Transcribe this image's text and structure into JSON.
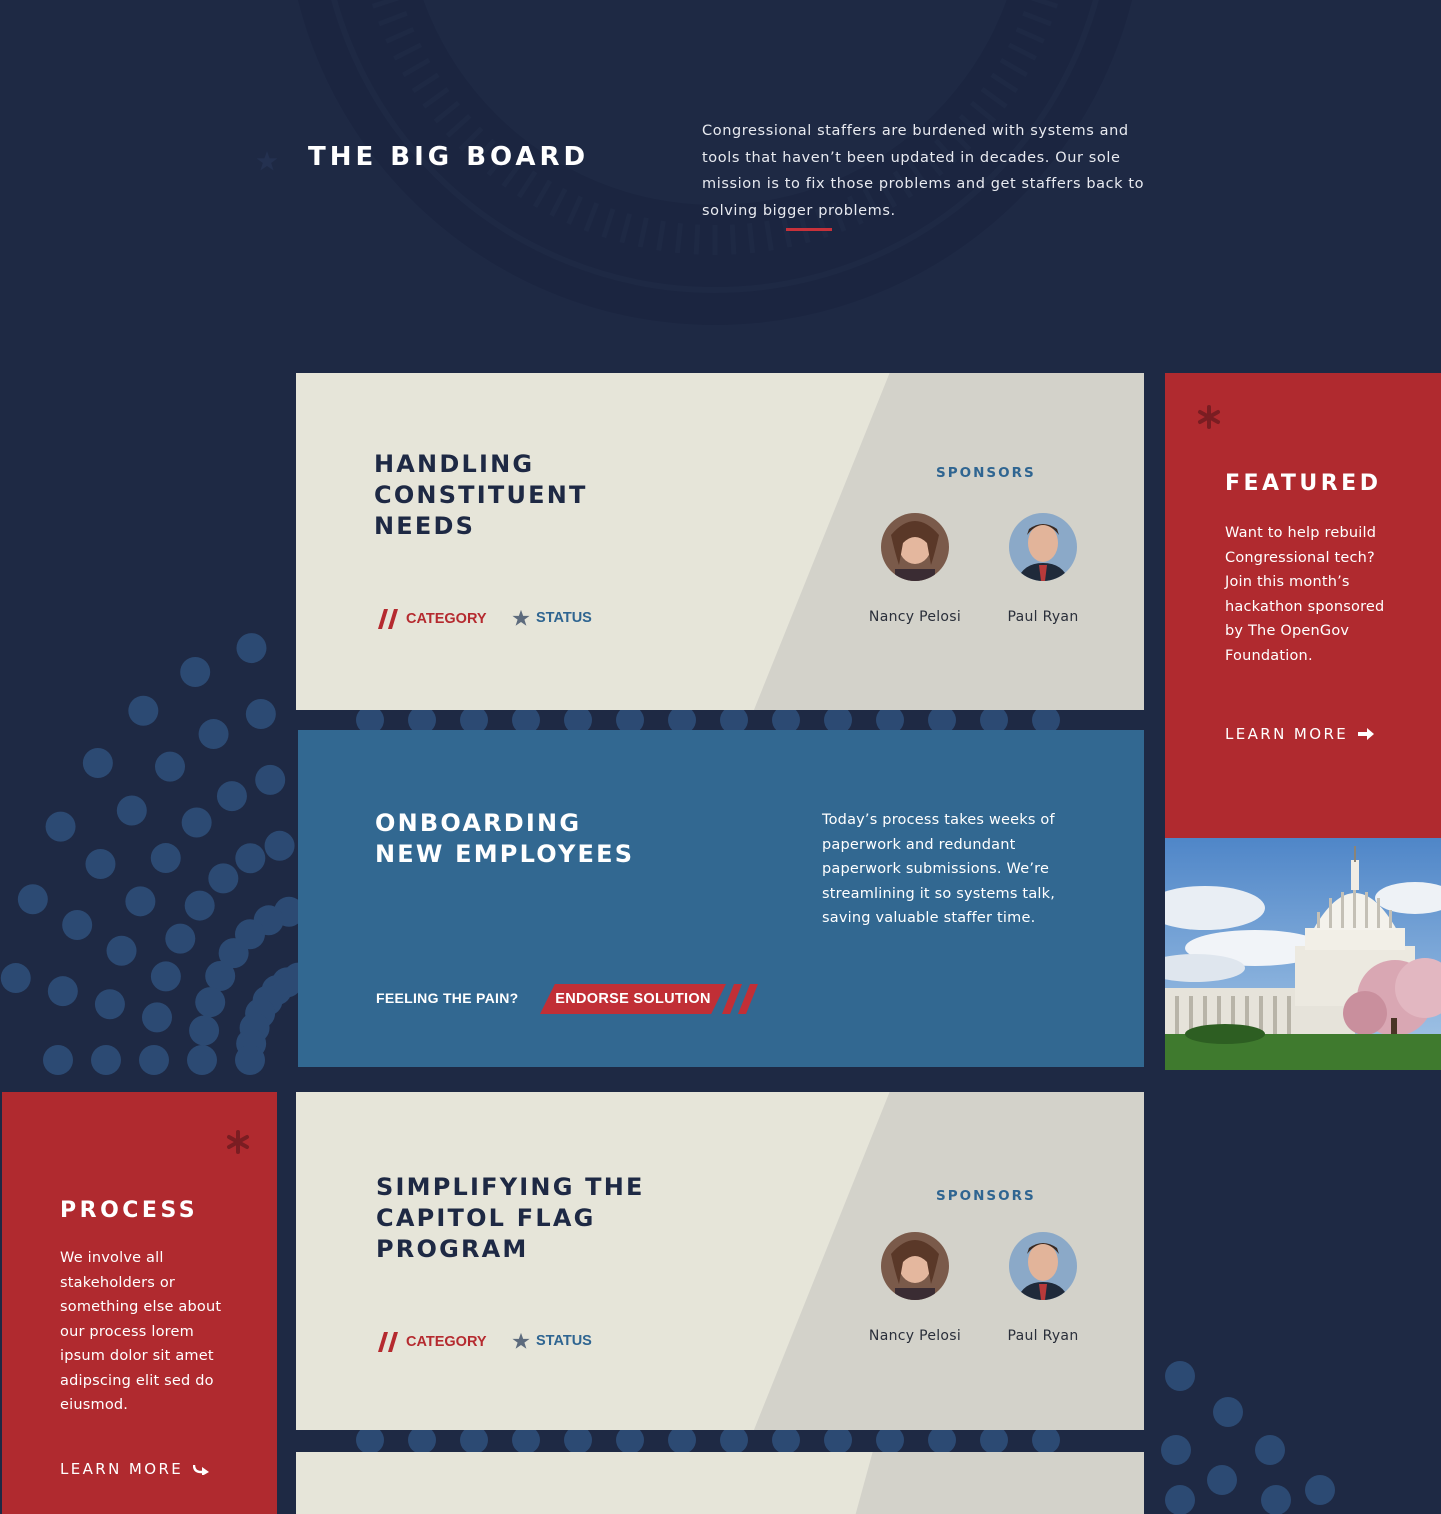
{
  "header": {
    "title": "THE BIG BOARD",
    "intro": "Congressional staffers are burdened with systems and tools that haven’t been updated in decades. Our sole mission is to fix those problems and get staffers back to solving bigger problems."
  },
  "cards": [
    {
      "title": "HANDLING\nCONSTITUENT\nNEEDS",
      "sponsors_label": "SPONSORS",
      "sponsors": [
        "Nancy Pelosi",
        "Paul Ryan"
      ],
      "category": "CATEGORY",
      "status": "STATUS"
    },
    {
      "title": "ONBOARDING\nNEW EMPLOYEES",
      "description": "Today’s process takes weeks of paperwork and redundant paperwork submissions. We’re streamlining it so systems talk, saving valuable staffer time.",
      "pain_label": "FEELING THE PAIN?",
      "endorse_label": "ENDORSE SOLUTION"
    },
    {
      "title": "SIMPLIFYING THE\nCAPITOL FLAG\nPROGRAM",
      "sponsors_label": "SPONSORS",
      "sponsors": [
        "Nancy Pelosi",
        "Paul Ryan"
      ],
      "category": "CATEGORY",
      "status": "STATUS"
    }
  ],
  "featured": {
    "title": "FEATURED",
    "text": "Want to help rebuild Congressional tech? Join this month’s hackathon sponsored by The OpenGov Foundation.",
    "link": "LEARN MORE"
  },
  "process": {
    "title": "PROCESS",
    "text": "We involve all stakeholders or something else about our process lorem ipsum dolor sit amet adipscing elit sed do eiusmod.",
    "link": "LEARN MORE"
  },
  "colors": {
    "navy": "#1e2944",
    "red": "#b02a2f",
    "blue": "#326891",
    "cream": "#e6e5d9"
  }
}
